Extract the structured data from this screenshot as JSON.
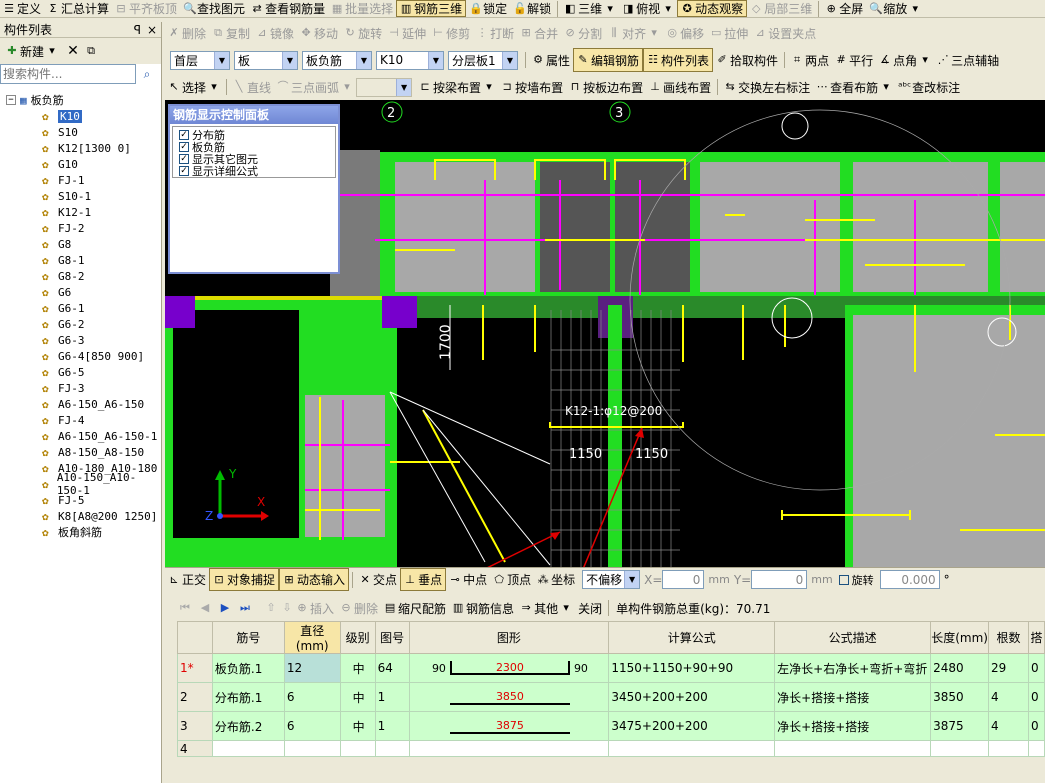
{
  "menubar": {
    "items": [
      {
        "label": "定义",
        "icon": "define-icon",
        "enabled": true
      },
      {
        "label": "汇总计算",
        "icon": "sigma-icon",
        "enabled": true
      },
      {
        "label": "平齐板顶",
        "icon": "align-icon",
        "enabled": false
      },
      {
        "label": "查找图元",
        "icon": "find-icon",
        "enabled": true
      },
      {
        "label": "查看钢筋量",
        "icon": "view-rebar-icon",
        "enabled": true
      },
      {
        "label": "批量选择",
        "icon": "batch-select-icon",
        "enabled": false
      },
      {
        "label": "钢筋三维",
        "icon": "rebar-3d-icon",
        "enabled": true,
        "active": true
      },
      {
        "label": "锁定",
        "icon": "lock-icon",
        "enabled": true
      },
      {
        "label": "解锁",
        "icon": "unlock-icon",
        "enabled": true
      },
      {
        "label": "三维",
        "icon": "3d-icon",
        "enabled": true
      },
      {
        "label": "俯视",
        "icon": "top-view-icon",
        "enabled": true
      },
      {
        "label": "动态观察",
        "icon": "orbit-icon",
        "enabled": true,
        "active": true
      },
      {
        "label": "局部三维",
        "icon": "local-3d-icon",
        "enabled": false
      },
      {
        "label": "全屏",
        "icon": "fullscreen-icon",
        "enabled": true
      },
      {
        "label": "缩放",
        "icon": "zoom-icon",
        "enabled": true
      }
    ]
  },
  "edit_toolbar": {
    "items": [
      {
        "label": "删除",
        "enabled": false
      },
      {
        "label": "复制",
        "enabled": false
      },
      {
        "label": "镜像",
        "enabled": false
      },
      {
        "label": "移动",
        "enabled": false
      },
      {
        "label": "旋转",
        "enabled": false
      },
      {
        "label": "延伸",
        "enabled": false
      },
      {
        "label": "修剪",
        "enabled": false
      },
      {
        "label": "打断",
        "enabled": false
      },
      {
        "label": "合并",
        "enabled": false
      },
      {
        "label": "分割",
        "enabled": false
      },
      {
        "label": "对齐",
        "enabled": false
      },
      {
        "label": "偏移",
        "enabled": false
      },
      {
        "label": "拉伸",
        "enabled": false
      },
      {
        "label": "设置夹点",
        "enabled": false
      }
    ]
  },
  "selector_bar": {
    "floor": "首层",
    "type": "板",
    "category": "板负筋",
    "component": "K10",
    "layer": "分层板1",
    "buttons": [
      "属性",
      "编辑钢筋",
      "构件列表",
      "拾取构件",
      "两点",
      "平行",
      "点角",
      "三点辅轴"
    ]
  },
  "draw_toolbar": {
    "select_label": "选择",
    "items": [
      {
        "label": "直线",
        "enabled": false
      },
      {
        "label": "三点画弧",
        "enabled": false
      },
      {
        "label": "按梁布置",
        "enabled": true
      },
      {
        "label": "按墙布置",
        "enabled": true
      },
      {
        "label": "按板边布置",
        "enabled": true
      },
      {
        "label": "画线布置",
        "enabled": true
      },
      {
        "label": "交换左右标注",
        "enabled": true
      },
      {
        "label": "查看布筋",
        "enabled": true
      },
      {
        "label": "查改标注",
        "enabled": true
      }
    ]
  },
  "left_panel": {
    "title": "构件列表",
    "pin": "ꟼ",
    "close": "×",
    "new_label": "新建",
    "search_placeholder": "搜索构件...",
    "root": "板负筋",
    "items": [
      "K10",
      "S10",
      "K12[1300 0]",
      "G10",
      "FJ-1",
      "S10-1",
      "K12-1",
      "FJ-2",
      "G8",
      "G8-1",
      "G8-2",
      "G6",
      "G6-1",
      "G6-2",
      "G6-3",
      "G6-4[850 900]",
      "G6-5",
      "FJ-3",
      "A6-150_A6-150",
      "FJ-4",
      "A6-150_A6-150-1",
      "A8-150_A8-150",
      "A10-180_A10-180",
      "A10-150_A10-150-1",
      "FJ-5",
      "K8[A8@200 1250]",
      "板角斜筋"
    ],
    "selected_index": 0
  },
  "control_panel": {
    "title": "钢筋显示控制面板",
    "options": [
      {
        "label": "分布筋",
        "checked": true
      },
      {
        "label": "板负筋",
        "checked": true
      },
      {
        "label": "显示其它图元",
        "checked": true
      },
      {
        "label": "显示详细公式",
        "checked": true
      }
    ]
  },
  "canvas": {
    "axis_labels": [
      "2",
      "3"
    ],
    "dim_vertical": "1700",
    "rebar_label": "K12-1:φ12@200",
    "dim_left": "1150",
    "dim_right": "1150",
    "ucs_x": "X",
    "ucs_y": "Y",
    "ucs_z": "Z"
  },
  "snap_bar": {
    "items": [
      "正交",
      "对象捕捉",
      "动态输入",
      "交点",
      "垂点",
      "中点",
      "顶点",
      "坐标"
    ],
    "offset_mode": "不偏移",
    "x_label": "X=",
    "x_value": "0",
    "y_label": "Y=",
    "y_value": "0",
    "unit": "mm",
    "rotate_label": "旋转",
    "rotate_value": "0.000",
    "degree": "°"
  },
  "grid_toolbar": {
    "insert": "插入",
    "delete": "删除",
    "scale": "缩尺配筋",
    "info": "钢筋信息",
    "other": "其他",
    "close": "关闭",
    "total_label": "单构件钢筋总重(kg)：70.71"
  },
  "rebar_table": {
    "headers": [
      "筋号",
      "直径(mm)",
      "级别",
      "图号",
      "图形",
      "计算公式",
      "公式描述",
      "长度(mm)",
      "根数",
      "搭"
    ],
    "rows": [
      {
        "no": "1*",
        "name": "板负筋.1",
        "dia": "12",
        "grade": "中",
        "fig": "64",
        "shape_left": "90",
        "shape_mid": "2300",
        "shape_right": "90",
        "formula": "1150+1150+90+90",
        "desc": "左净长+右净长+弯折+弯折",
        "length": "2480",
        "count": "29",
        "lap": "0"
      },
      {
        "no": "2",
        "name": "分布筋.1",
        "dia": "6",
        "grade": "中",
        "fig": "1",
        "shape_left": "",
        "shape_mid": "3850",
        "shape_right": "",
        "formula": "3450+200+200",
        "desc": "净长+搭接+搭接",
        "length": "3850",
        "count": "4",
        "lap": "0"
      },
      {
        "no": "3",
        "name": "分布筋.2",
        "dia": "6",
        "grade": "中",
        "fig": "1",
        "shape_left": "",
        "shape_mid": "3875",
        "shape_right": "",
        "formula": "3475+200+200",
        "desc": "净长+搭接+搭接",
        "length": "3875",
        "count": "4",
        "lap": "0"
      },
      {
        "no": "4",
        "name": "",
        "dia": "",
        "grade": "",
        "fig": "",
        "shape_left": "",
        "shape_mid": "",
        "shape_right": "",
        "formula": "",
        "desc": "",
        "length": "",
        "count": "",
        "lap": ""
      }
    ]
  },
  "colors": {
    "slab_green": "#22dd22",
    "rebar_magenta": "#ff00ff",
    "rebar_yellow": "#ffff00",
    "support_purple": "#7700cc",
    "panel_blue": "#7c8fd4"
  }
}
